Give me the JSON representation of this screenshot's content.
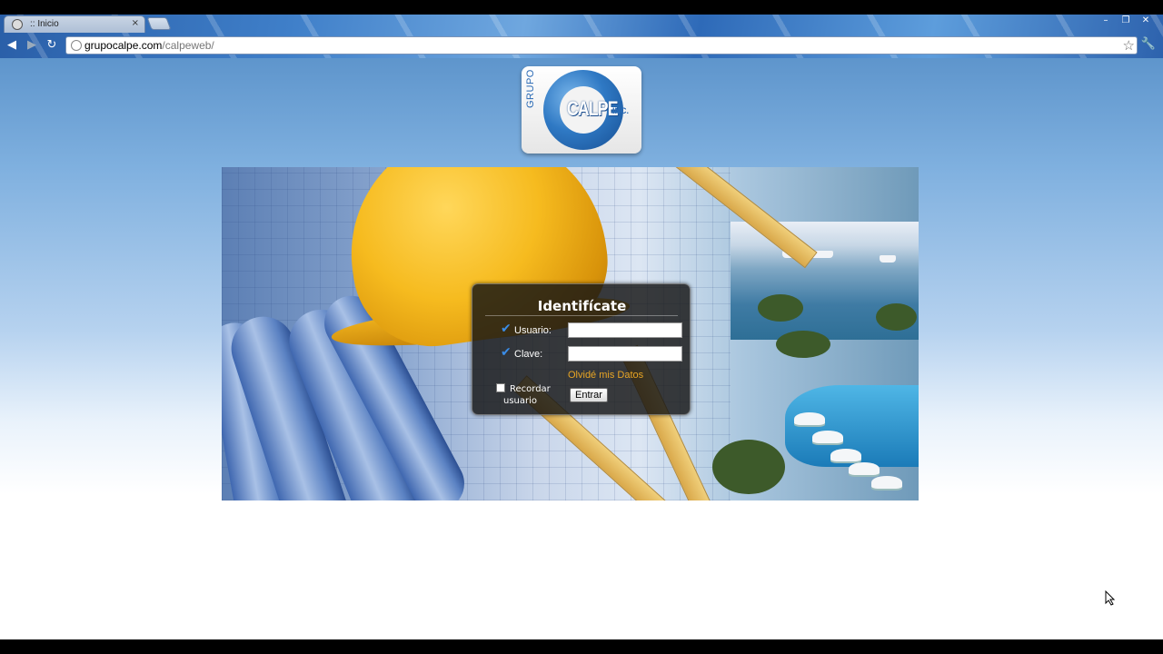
{
  "browser": {
    "tab_title": ":: Inicio",
    "tab_close": "×",
    "url_host": "grupocalpe.com",
    "url_path": "/calpeweb/",
    "win_minimize": "–",
    "win_restore": "❐",
    "win_close": "✕"
  },
  "logo": {
    "grupo": "GRUPO",
    "calpe": "CALPE",
    "inc": "INC."
  },
  "login": {
    "title": "Identifícate",
    "user_label": "Usuario:",
    "password_label": "Clave:",
    "user_value": "",
    "password_value": "",
    "forgot_link": "Olvidé mis Datos",
    "remember_label": "Recordar usuario",
    "submit_label": "Entrar"
  },
  "colors": {
    "check": "#3a8de8",
    "forgot_link": "#e8a524",
    "login_bg": "#141414"
  }
}
